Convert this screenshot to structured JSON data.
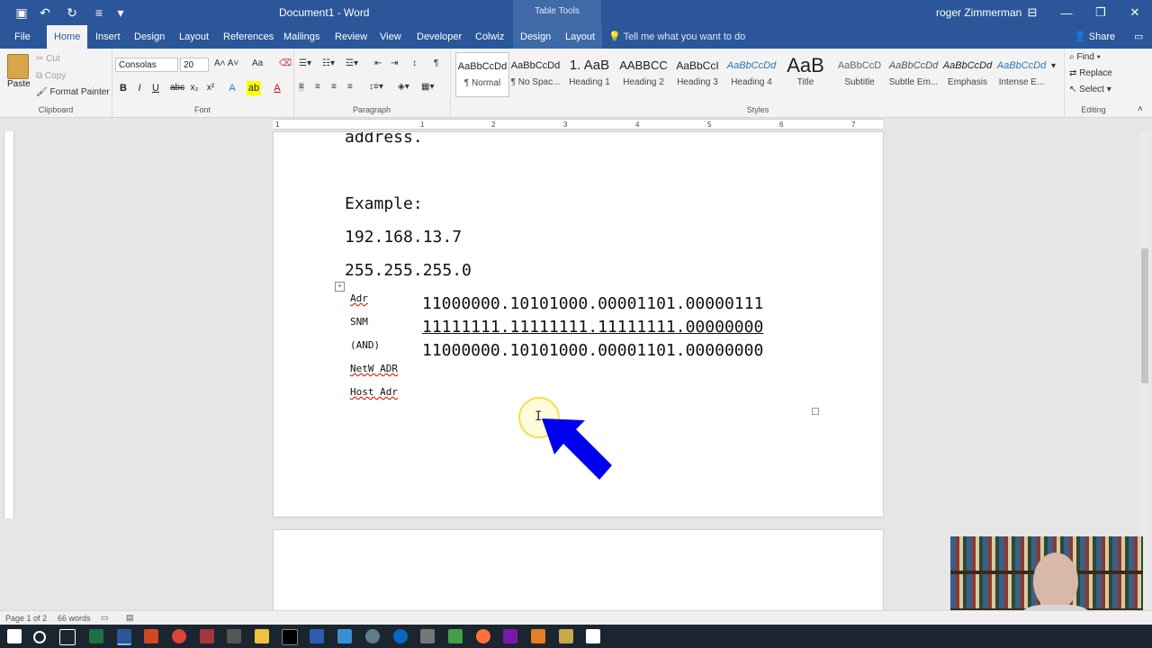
{
  "titlebar": {
    "doc_title": "Document1  -  Word",
    "context_label": "Table Tools",
    "user": "roger Zimmerman"
  },
  "tabs": [
    "File",
    "Home",
    "Insert",
    "Design",
    "Layout",
    "References",
    "Mailings",
    "Review",
    "View",
    "Developer",
    "Colwiz",
    "Design",
    "Layout"
  ],
  "active_tab": "Home",
  "tell_me": "Tell me what you want to do",
  "share": "Share",
  "clipboard": {
    "paste": "Paste",
    "cut": "Cut",
    "copy": "Copy",
    "format_painter": "Format Painter",
    "label": "Clipboard"
  },
  "font": {
    "name": "Consolas",
    "size": "20",
    "label": "Font"
  },
  "paragraph": {
    "label": "Paragraph"
  },
  "styles": {
    "label": "Styles",
    "items": [
      {
        "preview": "AaBbCcDd",
        "name": "¶ Normal"
      },
      {
        "preview": "AaBbCcDd",
        "name": "¶ No Spac..."
      },
      {
        "preview": "1.  AaB",
        "name": "Heading 1"
      },
      {
        "preview": "AABBCC",
        "name": "Heading 2"
      },
      {
        "preview": "AaBbCcI",
        "name": "Heading 3"
      },
      {
        "preview": "AaBbCcDd",
        "name": "Heading 4"
      },
      {
        "preview": "AaB",
        "name": "Title"
      },
      {
        "preview": "AaBbCcD",
        "name": "Subtitle"
      },
      {
        "preview": "AaBbCcDd",
        "name": "Subtle Em..."
      },
      {
        "preview": "AaBbCcDd",
        "name": "Emphasis"
      },
      {
        "preview": "AaBbCcDd",
        "name": "Intense E..."
      }
    ]
  },
  "editing": {
    "find": "Find",
    "replace": "Replace",
    "select": "Select",
    "label": "Editing"
  },
  "ruler_numbers": [
    "1",
    "1",
    "2",
    "3",
    "4",
    "5",
    "6",
    "7"
  ],
  "document": {
    "line_cut": "address.",
    "example_label": "Example:",
    "ip": "192.168.13.7",
    "mask": "255.255.255.0",
    "table": {
      "labels": [
        "Adr",
        "SNM",
        "(AND)",
        "NetW ADR",
        "Host Adr"
      ],
      "rows": [
        "11000000.10101000.00001101.00000111",
        "11111111.11111111.11111111.00000000",
        "11000000.10101000.00001101.00000000"
      ]
    }
  },
  "status": {
    "page": "Page 1 of 2",
    "words": "66 words"
  },
  "colors": {
    "brand": "#2b579a",
    "arrow": "#0000ee",
    "cursor_ring": "#f5e04a"
  }
}
